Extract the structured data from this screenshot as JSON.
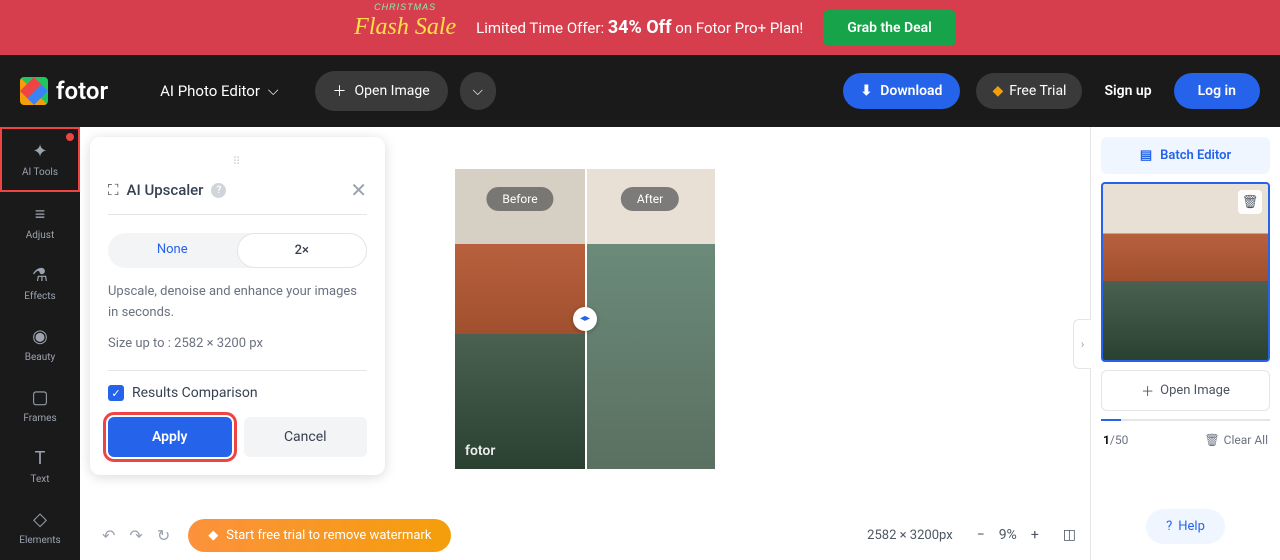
{
  "banner": {
    "sale_text": "Flash Sale",
    "offer_prefix": "Limited Time Offer: ",
    "offer_discount": "34% Off",
    "offer_suffix": " on Fotor Pro+ Plan!",
    "cta": "Grab the Deal"
  },
  "topbar": {
    "logo": "fotor",
    "editor_dropdown": "AI Photo Editor",
    "open_image": "Open Image",
    "download": "Download",
    "free_trial": "Free Trial",
    "sign_up": "Sign up",
    "log_in": "Log in"
  },
  "sidebar": {
    "items": [
      {
        "label": "AI Tools",
        "active": true
      },
      {
        "label": "Adjust",
        "active": false
      },
      {
        "label": "Effects",
        "active": false
      },
      {
        "label": "Beauty",
        "active": false
      },
      {
        "label": "Frames",
        "active": false
      },
      {
        "label": "Text",
        "active": false
      },
      {
        "label": "Elements",
        "active": false
      }
    ]
  },
  "panel": {
    "title": "AI Upscaler",
    "options": {
      "none": "None",
      "two_x": "2×"
    },
    "desc": "Upscale, denoise and enhance your images in seconds.",
    "size_line": "Size up to : 2582 × 3200 px",
    "checkbox_label": "Results Comparison",
    "apply": "Apply",
    "cancel": "Cancel"
  },
  "canvas": {
    "before_label": "Before",
    "after_label": "After",
    "watermark": "fotor"
  },
  "bottombar": {
    "trial_text": "Start free trial to remove watermark",
    "dimensions": "2582 × 3200px",
    "zoom": "9%"
  },
  "right": {
    "batch": "Batch Editor",
    "open_image": "Open Image",
    "count": "1",
    "count_total": "/50",
    "clear_all": "Clear All",
    "help": "Help"
  }
}
